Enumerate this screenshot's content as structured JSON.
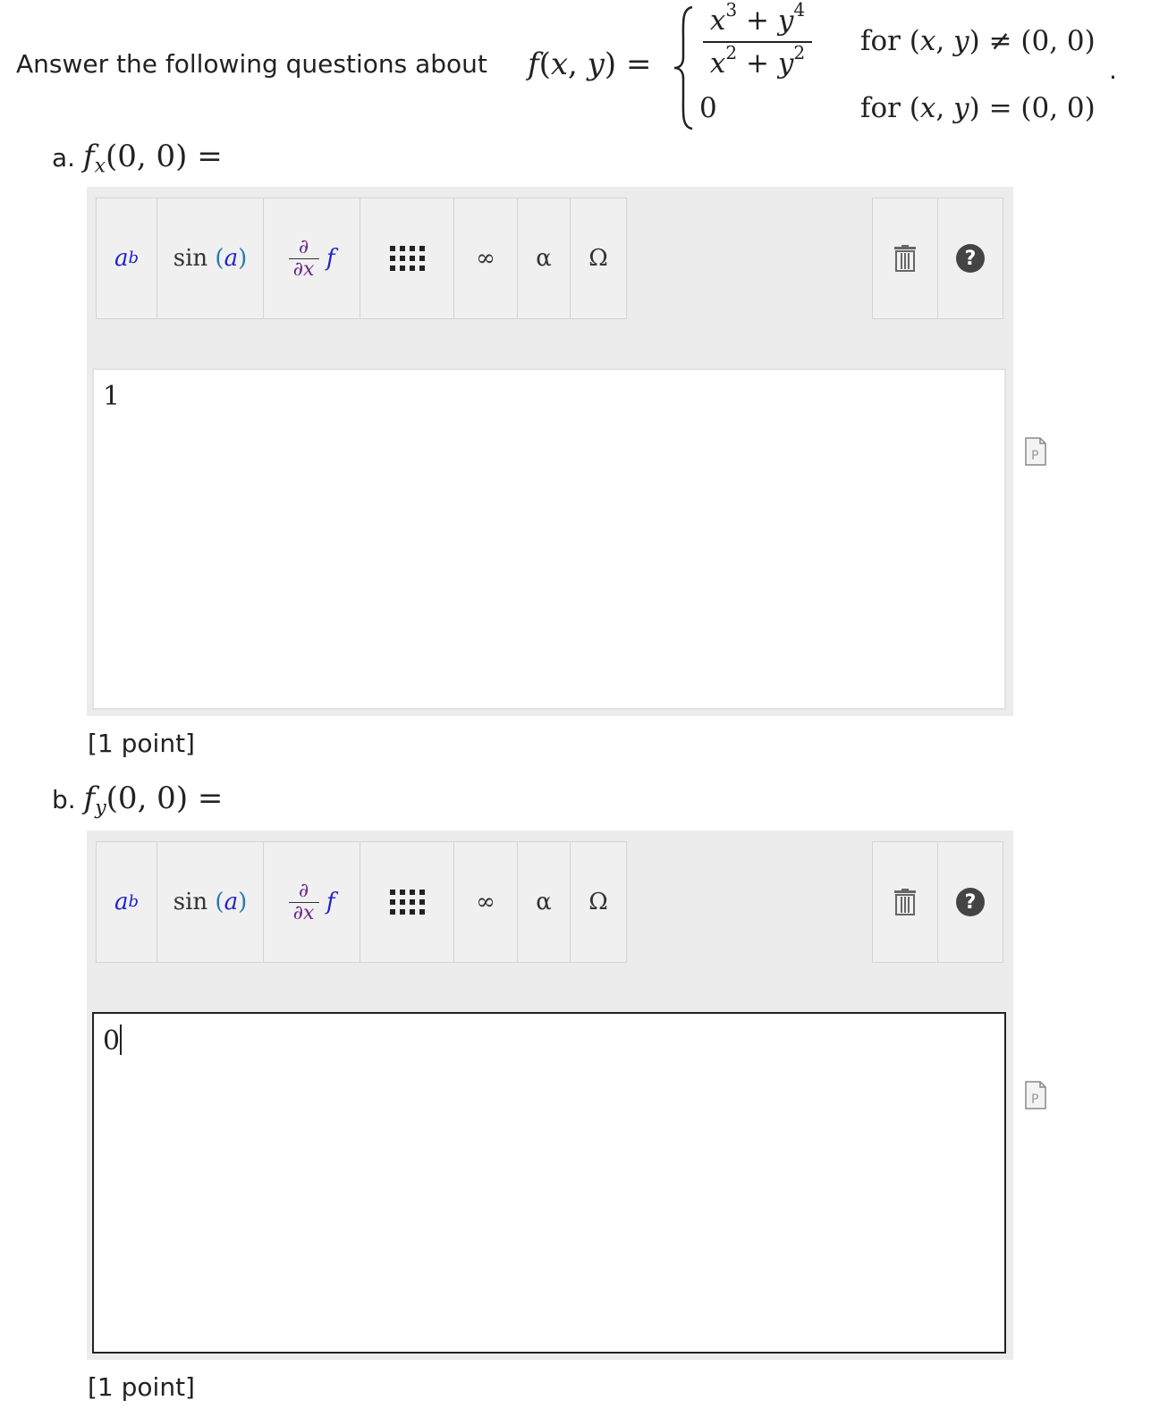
{
  "question": {
    "intro": "Answer the following questions about",
    "function_label": "f(x, y) =",
    "numerator": "x³ + y⁴",
    "denominator": "x² + y²",
    "case_zero": "0",
    "condition_1": "for (x, y) ≠ (0, 0)",
    "condition_2": "for (x, y) = (0, 0)",
    "period": "."
  },
  "parts": [
    {
      "letter": "a.",
      "prompt": "fₓ(0, 0) =",
      "answer": "1",
      "points": "[1 point]"
    },
    {
      "letter": "b.",
      "prompt": "f_y(0, 0) =",
      "answer": "0",
      "points": "[1 point]"
    }
  ],
  "toolbar": {
    "superscript": "a^b",
    "function": "sin (a)",
    "derivative": "∂/∂x f",
    "matrix": "matrix",
    "infinity": "∞",
    "greek": "α",
    "symbols": "Ω",
    "clear": "trash",
    "help": "?"
  },
  "icons": {
    "trash": "trash-icon",
    "help": "help-icon",
    "matrix": "matrix-icon",
    "pdf": "pdf-icon"
  }
}
